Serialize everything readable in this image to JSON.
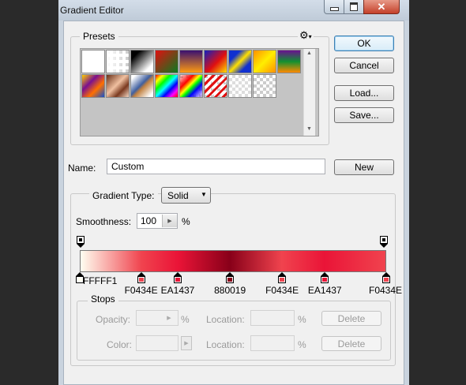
{
  "window": {
    "title": "Gradient Editor"
  },
  "titlebar_buttons": {
    "minimize_icon": "minimize-icon",
    "maximize_icon": "maximize-icon",
    "close_icon": "close-icon"
  },
  "presets": {
    "legend": "Presets",
    "menu_icon": "gear-icon",
    "swatches": [
      "foreground-to-background",
      "foreground-to-transparent",
      "black-white",
      "red-green",
      "violet-orange",
      "blue-red-yellow",
      "blue-yellow-blue",
      "orange-yellow-orange",
      "violet-green-orange",
      "yellow-violet-orange-blue",
      "copper",
      "chrome",
      "spectrum",
      "transparent-rainbow",
      "transparent-stripes",
      "transparent-checker-1",
      "transparent-checker-2"
    ]
  },
  "buttons": {
    "ok": "OK",
    "cancel": "Cancel",
    "load": "Load...",
    "save": "Save...",
    "new": "New"
  },
  "name": {
    "label": "Name:",
    "value": "Custom"
  },
  "gradient_type": {
    "label": "Gradient Type:",
    "value": "Solid"
  },
  "smoothness": {
    "label": "Smoothness:",
    "value": "100",
    "unit": "%"
  },
  "gradient": {
    "color_stops": [
      {
        "hex": "FFFFF1",
        "color": "#FFFFF1",
        "location": 0
      },
      {
        "hex": "F0434E",
        "color": "#F0434E",
        "location": 20
      },
      {
        "hex": "EA1437",
        "color": "#EA1437",
        "location": 32
      },
      {
        "hex": "880019",
        "color": "#880019",
        "location": 49
      },
      {
        "hex": "F0434E",
        "color": "#F0434E",
        "location": 66
      },
      {
        "hex": "EA1437",
        "color": "#EA1437",
        "location": 80
      },
      {
        "hex": "F0434E",
        "color": "#F0434E",
        "location": 100
      }
    ],
    "opacity_stops": [
      {
        "location": 0
      },
      {
        "location": 100
      }
    ]
  },
  "stops": {
    "legend": "Stops",
    "opacity_label": "Opacity:",
    "opacity_unit": "%",
    "location_label": "Location:",
    "location_unit": "%",
    "color_label": "Color:",
    "delete_label": "Delete"
  }
}
